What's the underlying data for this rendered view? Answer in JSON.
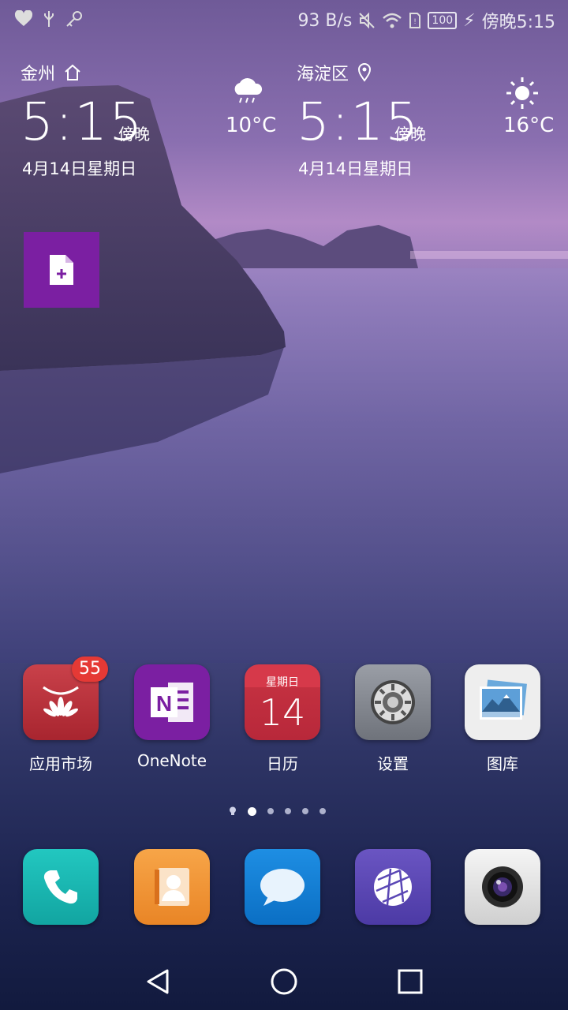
{
  "statusbar": {
    "speed": "93 B/s",
    "battery": "100",
    "time": "傍晚5:15",
    "icons": [
      "heart-rate-icon",
      "usb-icon",
      "key-icon",
      "mute-icon",
      "wifi-icon",
      "sim-icon",
      "battery-icon",
      "charging-icon"
    ]
  },
  "widget_left": {
    "city": "金州",
    "time": "5:15",
    "ampm": "傍晚",
    "date": "4月14日星期日",
    "temp": "10°C",
    "weather": "cloud-rain-icon"
  },
  "widget_right": {
    "city": "海淀区",
    "time": "5:15",
    "ampm": "傍晚",
    "date": "4月14日星期日",
    "temp": "16°C",
    "weather": "sun-icon"
  },
  "apps": [
    {
      "label": "应用市场",
      "icon": "huawei-appgallery-icon",
      "badge": "55"
    },
    {
      "label": "OneNote",
      "icon": "onenote-icon"
    },
    {
      "label": "日历",
      "icon": "calendar-icon",
      "calendar_weekday": "星期日",
      "calendar_day": "14"
    },
    {
      "label": "设置",
      "icon": "settings-gear-icon"
    },
    {
      "label": "图库",
      "icon": "gallery-icon"
    }
  ],
  "dock": [
    "phone-icon",
    "contacts-icon",
    "messages-icon",
    "browser-icon",
    "camera-icon"
  ],
  "colors": {
    "onenote": "#7b1fa2",
    "badge": "#e53935"
  }
}
